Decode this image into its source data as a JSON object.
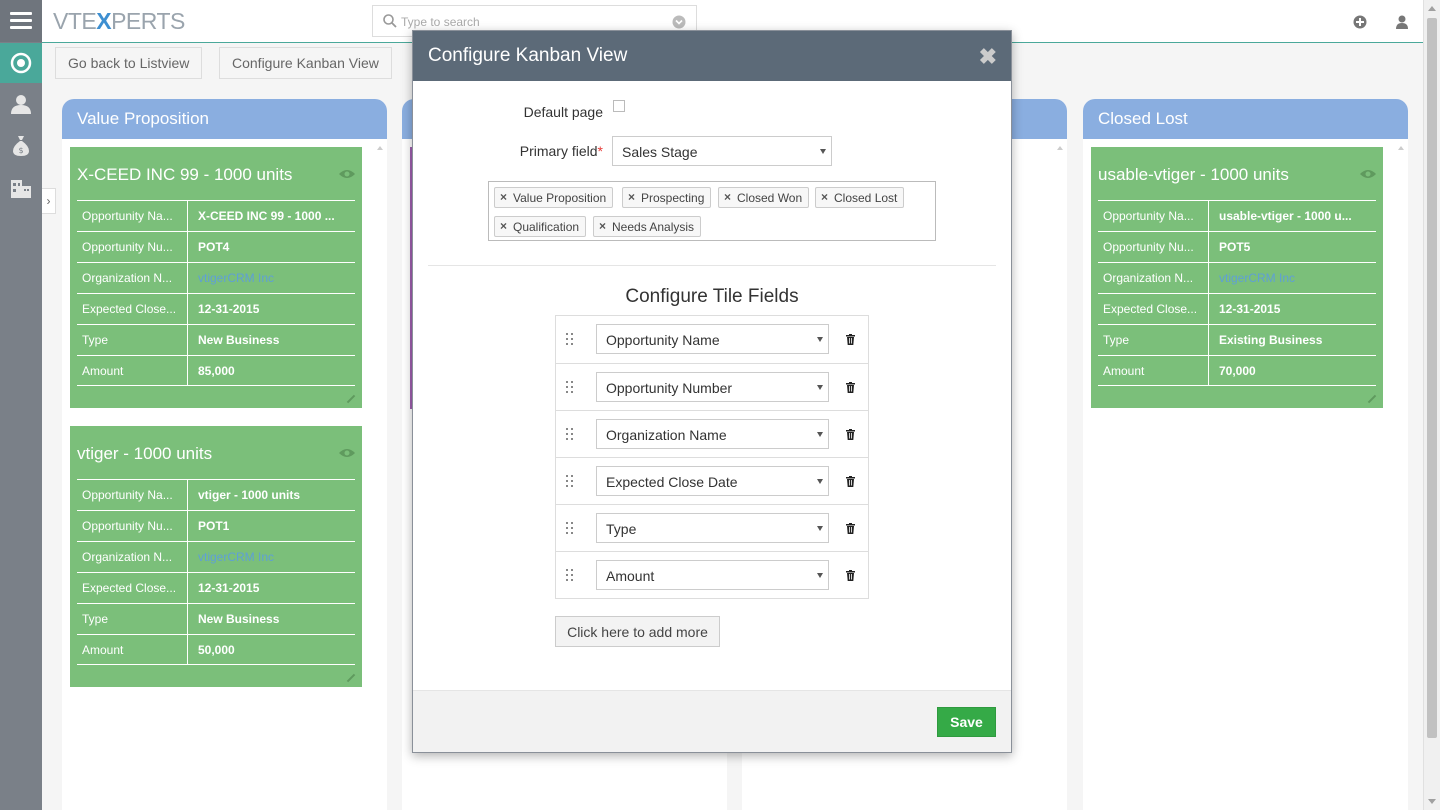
{
  "app": {
    "logo_prefix": "VTE",
    "logo_x": "X",
    "logo_suffix": "PERTS",
    "search_placeholder": "Type to search"
  },
  "actions": {
    "back_label": "Go back to Listview",
    "configure_label": "Configure Kanban View"
  },
  "columns": [
    {
      "title": "Value Proposition",
      "cards": [
        {
          "title": "X-CEED INC 99 - 1000 units",
          "rows": [
            {
              "label": "Opportunity Na...",
              "value": "X-CEED INC 99 - 1000 ..."
            },
            {
              "label": "Opportunity Nu...",
              "value": "POT4"
            },
            {
              "label": "Organization N...",
              "value": "vtigerCRM Inc"
            },
            {
              "label": "Expected Close...",
              "value": "12-31-2015"
            },
            {
              "label": "Type",
              "value": "New Business"
            },
            {
              "label": "Amount",
              "value": "85,000"
            }
          ]
        },
        {
          "title": "vtiger - 1000 units",
          "rows": [
            {
              "label": "Opportunity Na...",
              "value": "vtiger - 1000 units"
            },
            {
              "label": "Opportunity Nu...",
              "value": "POT1"
            },
            {
              "label": "Organization N...",
              "value": "vtigerCRM Inc"
            },
            {
              "label": "Expected Close...",
              "value": "12-31-2015"
            },
            {
              "label": "Type",
              "value": "New Business"
            },
            {
              "label": "Amount",
              "value": "50,000"
            }
          ]
        }
      ]
    },
    {
      "title": "Closed Lost",
      "cards": [
        {
          "title": "usable-vtiger - 1000 units",
          "rows": [
            {
              "label": "Opportunity Na...",
              "value": "usable-vtiger - 1000 u..."
            },
            {
              "label": "Opportunity Nu...",
              "value": "POT5"
            },
            {
              "label": "Organization N...",
              "value": "vtigerCRM Inc"
            },
            {
              "label": "Expected Close...",
              "value": "12-31-2015"
            },
            {
              "label": "Type",
              "value": "Existing Business"
            },
            {
              "label": "Amount",
              "value": "70,000"
            }
          ]
        }
      ]
    }
  ],
  "modal": {
    "title": "Configure Kanban View",
    "close_glyph": "✖",
    "default_page_label": "Default page",
    "primary_field_label": "Primary field",
    "required_mark": "*",
    "primary_field_value": "Sales Stage",
    "tags": [
      "Value Proposition",
      "Prospecting",
      "Closed Won",
      "Closed Lost",
      "Qualification",
      "Needs Analysis"
    ],
    "tag_remove_glyph": "×",
    "tile_fields_title": "Configure Tile Fields",
    "tile_fields": [
      "Opportunity Name",
      "Opportunity Number",
      "Organization Name",
      "Expected Close Date",
      "Type",
      "Amount"
    ],
    "add_more_label": "Click here to add more",
    "save_label": "Save"
  },
  "colors": {
    "accent": "#4aa89a",
    "column_header": "#8aaee0",
    "card": "#7bbf7a",
    "modal_header": "#5c6a78",
    "save": "#35aa47"
  }
}
